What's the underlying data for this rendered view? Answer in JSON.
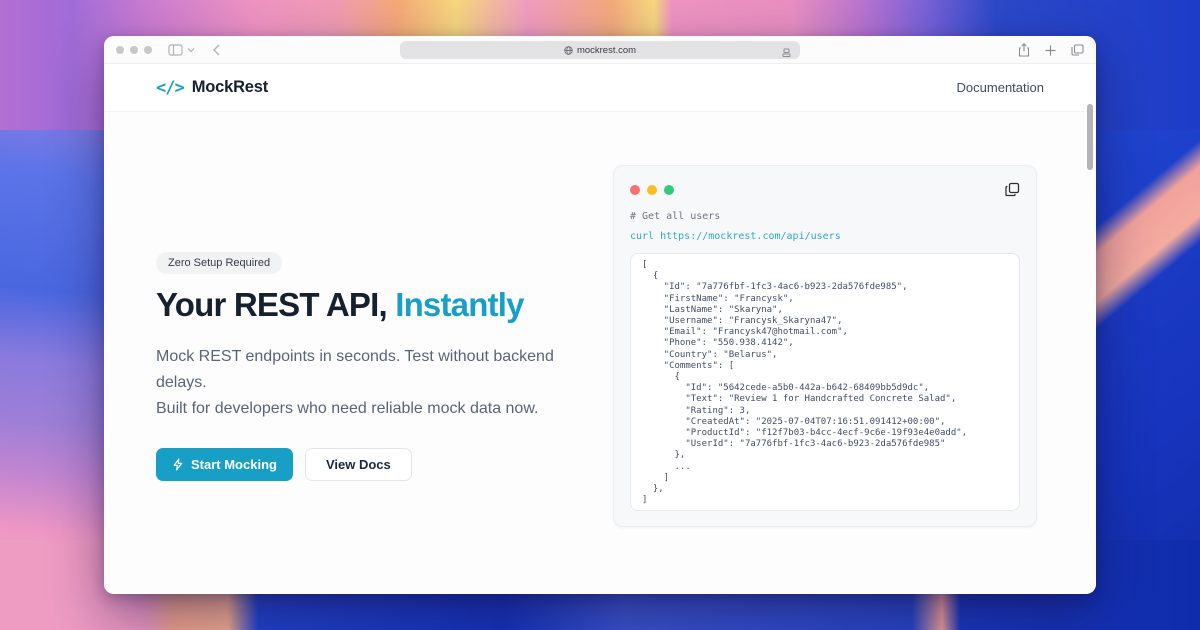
{
  "colors": {
    "accent": "#189fc6",
    "heading": "#16202e",
    "curl_text": "#2fa8cc",
    "panel_dot_red": "#f87171",
    "panel_dot_yellow": "#fbbd23",
    "panel_dot_green": "#33cb7a"
  },
  "browser": {
    "url": "mockrest.com"
  },
  "header": {
    "logo_glyph": "</>",
    "brand": "MockRest",
    "nav_doc_label": "Documentation"
  },
  "hero": {
    "badge": "Zero Setup Required",
    "title_prefix": "Your REST API, ",
    "title_accent": "Instantly",
    "description": "Mock REST endpoints in seconds. Test without backend delays.\nBuilt for developers who need reliable mock data now.",
    "primary_cta": "Start Mocking",
    "secondary_cta": "View Docs"
  },
  "code_panel": {
    "comment": "# Get all users",
    "command": "curl https://mockrest.com/api/users",
    "response_json": "[\n  {\n    \"Id\": \"7a776fbf-1fc3-4ac6-b923-2da576fde985\",\n    \"FirstName\": \"Francysk\",\n    \"LastName\": \"Skaryna\",\n    \"Username\": \"Francysk_Skaryna47\",\n    \"Email\": \"Francysk47@hotmail.com\",\n    \"Phone\": \"550.938.4142\",\n    \"Country\": \"Belarus\",\n    \"Comments\": [\n      {\n        \"Id\": \"5642cede-a5b0-442a-b642-68409bb5d9dc\",\n        \"Text\": \"Review 1 for Handcrafted Concrete Salad\",\n        \"Rating\": 3,\n        \"CreatedAt\": \"2025-07-04T07:16:51.091412+00:00\",\n        \"ProductId\": \"f12f7b03-b4cc-4ecf-9c6e-19f93e4e0add\",\n        \"UserId\": \"7a776fbf-1fc3-4ac6-b923-2da576fde985\"\n      },\n      ...\n    ]\n  },\n]"
  }
}
